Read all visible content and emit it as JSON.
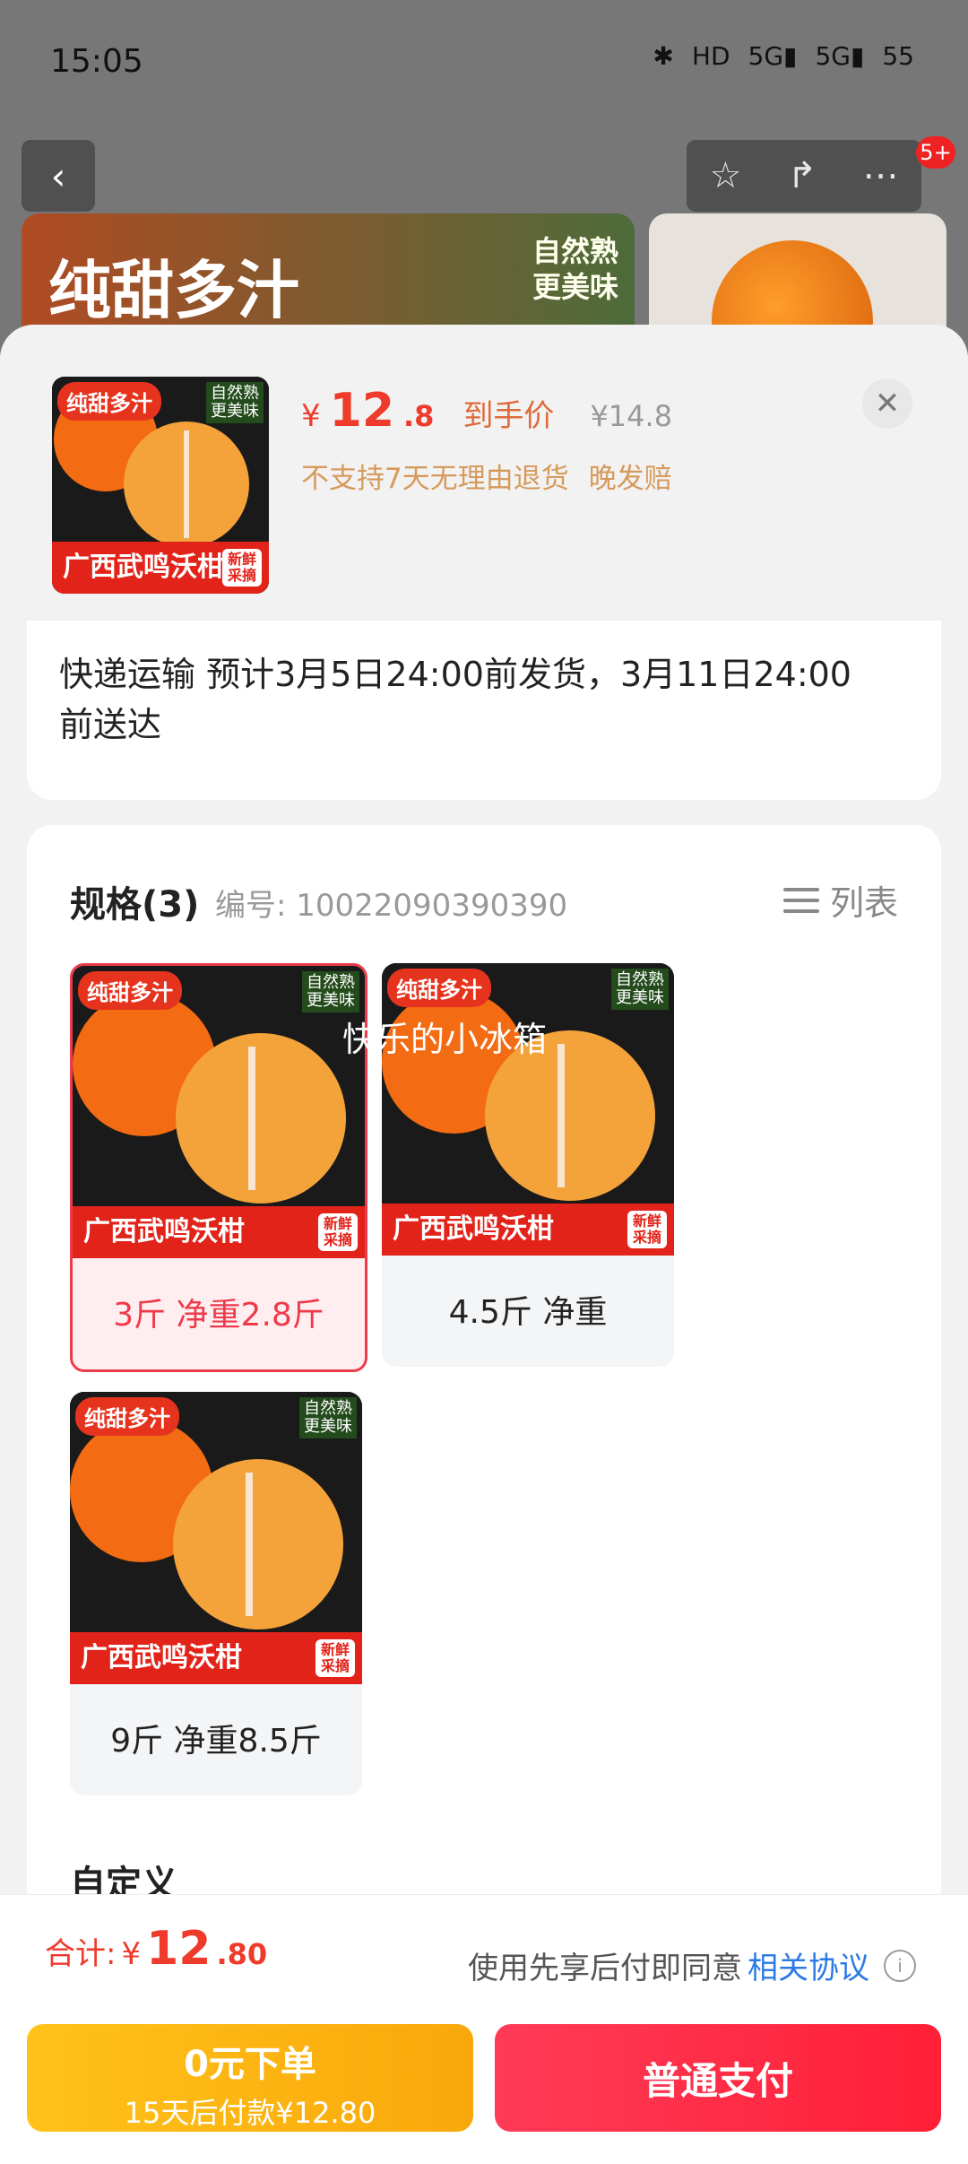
{
  "status_bar": {
    "time": "15:05",
    "icons": [
      "bluetooth-icon",
      "hd-icon",
      "signal-5g-icon",
      "signal-5g-icon",
      "battery-icon"
    ],
    "battery_text": "55"
  },
  "top_nav": {
    "back_icon": "chevron-left-icon",
    "star_icon": "star-icon",
    "share_icon": "share-icon",
    "more_icon": "more-icon",
    "badge": "5+"
  },
  "background": {
    "banner_text": "纯甜多汁",
    "banner_tag": "自然熟\n更美味"
  },
  "product": {
    "price_symbol": "¥",
    "price_int": "12",
    "price_dec": ".8",
    "price_note": "到手价",
    "original_price": "¥14.8",
    "policies": [
      "不支持7天无理由退货",
      "晚发赔"
    ],
    "image_caption": "广西武鸣沃柑",
    "image_badge": "纯甜多汁",
    "image_badge_right": "自然熟\n更美味",
    "fresh_tag": "新鲜\n采摘"
  },
  "delivery": {
    "text": "快递运输 预计3月5日24:00前发货，3月11日24:00前送达"
  },
  "spec": {
    "title": "规格(3)",
    "code": "编号: 10022090390390",
    "list_label": "列表",
    "items": [
      {
        "label": "3斤 净重2.8斤",
        "selected": true
      },
      {
        "label": "4.5斤 净重",
        "selected": false
      },
      {
        "label": "9斤 净重8.5斤",
        "selected": false
      }
    ],
    "watermark": "快乐的小冰箱"
  },
  "custom": {
    "title": "自定义"
  },
  "footer": {
    "total_label": "合计:",
    "total_symbol": "¥",
    "total_int": "12",
    "total_dec": ".80",
    "agreement_prefix": "使用先享后付即同意",
    "agreement_link": "相关协议",
    "zero_main": "0元下单",
    "zero_sub": "15天后付款¥12.80",
    "normal_pay": "普通支付"
  },
  "colors": {
    "price_red": "#ee3b2b",
    "accent_yellow": "#ffc21a",
    "pay_red": "#ff1f36",
    "link_blue": "#2c7be5"
  }
}
